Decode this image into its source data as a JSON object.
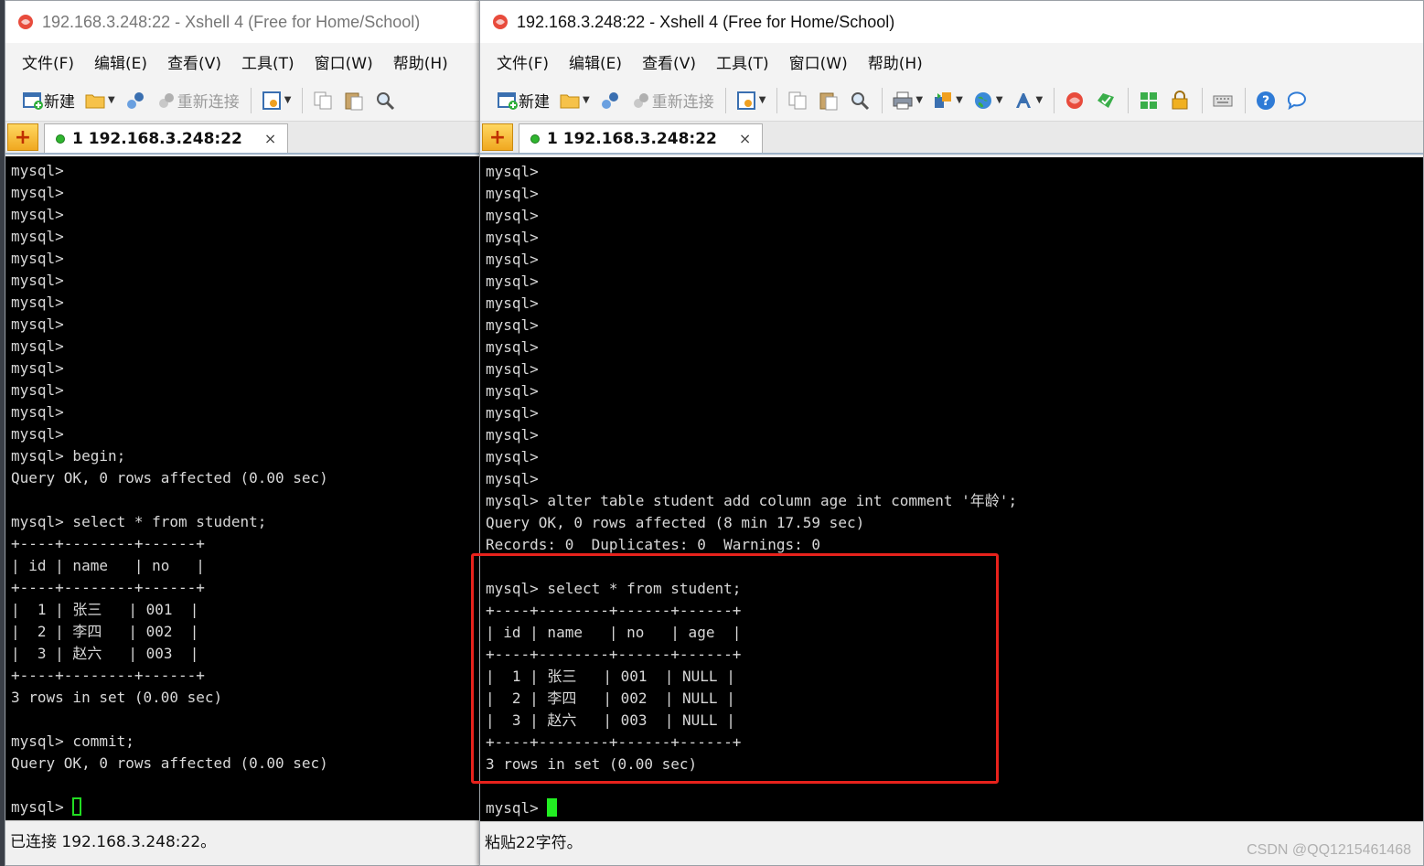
{
  "left_window": {
    "title": "192.168.3.248:22 - Xshell 4 (Free for Home/School)",
    "menus": [
      "文件(F)",
      "编辑(E)",
      "查看(V)",
      "工具(T)",
      "窗口(W)",
      "帮助(H)"
    ],
    "toolbar": {
      "new_label": "新建",
      "reconnect_label": "重新连接"
    },
    "tab": {
      "label": "1 192.168.3.248:22",
      "close": "×"
    },
    "terminal_lines": [
      "mysql>",
      "mysql>",
      "mysql>",
      "mysql>",
      "mysql>",
      "mysql>",
      "mysql>",
      "mysql>",
      "mysql>",
      "mysql>",
      "mysql>",
      "mysql>",
      "mysql>",
      "mysql> begin;",
      "Query OK, 0 rows affected (0.00 sec)",
      "",
      "mysql> select * from student;",
      "+----+--------+------+",
      "| id | name   | no   |",
      "+----+--------+------+",
      "|  1 | 张三   | 001  |",
      "|  2 | 李四   | 002  |",
      "|  3 | 赵六   | 003  |",
      "+----+--------+------+",
      "3 rows in set (0.00 sec)",
      "",
      "mysql> commit;",
      "Query OK, 0 rows affected (0.00 sec)",
      ""
    ],
    "prompt": "mysql> ",
    "status": "已连接 192.168.3.248:22。"
  },
  "right_window": {
    "title": "192.168.3.248:22 - Xshell 4 (Free for Home/School)",
    "menus": [
      "文件(F)",
      "编辑(E)",
      "查看(V)",
      "工具(T)",
      "窗口(W)",
      "帮助(H)"
    ],
    "toolbar": {
      "new_label": "新建",
      "reconnect_label": "重新连接"
    },
    "tab": {
      "label": "1 192.168.3.248:22",
      "close": "×"
    },
    "terminal_lines": [
      "mysql>",
      "mysql>",
      "mysql>",
      "mysql>",
      "mysql>",
      "mysql>",
      "mysql>",
      "mysql>",
      "mysql>",
      "mysql>",
      "mysql>",
      "mysql>",
      "mysql>",
      "mysql>",
      "mysql>",
      "mysql> alter table student add column age int comment '年龄';",
      "Query OK, 0 rows affected (8 min 17.59 sec)",
      "Records: 0  Duplicates: 0  Warnings: 0",
      "",
      "mysql> select * from student;",
      "+----+--------+------+------+",
      "| id | name   | no   | age  |",
      "+----+--------+------+------+",
      "|  1 | 张三   | 001  | NULL |",
      "|  2 | 李四   | 002  | NULL |",
      "|  3 | 赵六   | 003  | NULL |",
      "+----+--------+------+------+",
      "3 rows in set (0.00 sec)",
      ""
    ],
    "prompt": "mysql> ",
    "status": "粘贴22字符。"
  },
  "watermark": "CSDN @QQ1215461468",
  "colors": {
    "highlight": "#e8221c",
    "cursor": "#22ee22",
    "terminal_bg": "#000000"
  }
}
